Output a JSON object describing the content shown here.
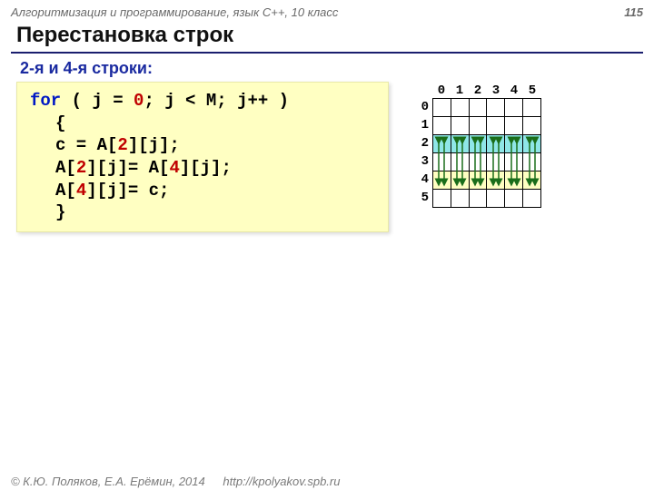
{
  "header": {
    "course": "Алгоритмизация и программирование, язык C++, 10 класс",
    "page": "115"
  },
  "title": "Перестановка строк",
  "subtitle": "2-я и 4-я строки:",
  "code": {
    "l1_kw": "for",
    "l1_a": " ( j = ",
    "l1_n1": "0",
    "l1_b": "; j < M; j++ )",
    "l2": "{",
    "l3_a": "c = A[",
    "l3_n": "2",
    "l3_b": "][j];",
    "l4_a": "A[",
    "l4_n1": "2",
    "l4_b": "][j]= A[",
    "l4_n2": "4",
    "l4_c": "][j];",
    "l5_a": "A[",
    "l5_n": "4",
    "l5_b": "][j]= c;",
    "l6": "}"
  },
  "grid": {
    "cols": [
      "0",
      "1",
      "2",
      "3",
      "4",
      "5"
    ],
    "rows": [
      "0",
      "1",
      "2",
      "3",
      "4",
      "5"
    ],
    "highlight_rows": [
      2,
      4
    ]
  },
  "footer": {
    "copyright": "© К.Ю. Поляков, Е.А. Ерёмин, 2014",
    "url": "http://kpolyakov.spb.ru"
  }
}
